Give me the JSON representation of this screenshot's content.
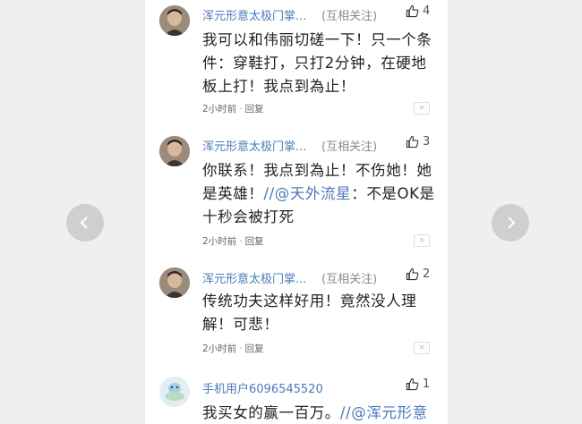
{
  "comments": [
    {
      "username": "浑元形意太极门掌...",
      "follow": "(互相关注)",
      "likes": "4",
      "text": "我可以和伟丽切磋一下！只一个条件：穿鞋打，只打2分钟，在硬地板上打！我点到為止！",
      "time": "2小时前",
      "reply": "回复",
      "close": "×"
    },
    {
      "username": "浑元形意太极门掌...",
      "follow": "(互相关注)",
      "likes": "3",
      "text_before": "你联系！我点到為止！不伤她！她是英雄！",
      "mention": "//@天外流星",
      "text_after": "：不是OK是十秒会被打死",
      "time": "2小时前",
      "reply": "回复",
      "close": "×"
    },
    {
      "username": "浑元形意太极门掌...",
      "follow": "(互相关注)",
      "likes": "2",
      "text": "传统功夫这样好用！竟然没人理解！可悲！",
      "time": "2小时前",
      "reply": "回复",
      "close": "×"
    },
    {
      "username": "手机用户6096545520",
      "likes": "1",
      "text_before": "我买女的赢一百万。",
      "mention": "//@浑元形意"
    }
  ],
  "nav": {
    "prev_icon": "chevron-left-icon",
    "next_icon": "chevron-right-icon"
  },
  "colors": {
    "link": "#4a7bb8",
    "background": "#efefef",
    "panel": "#ffffff"
  }
}
